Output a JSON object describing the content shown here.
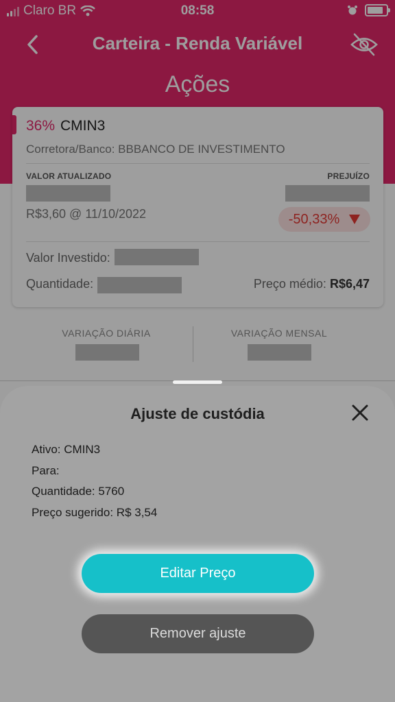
{
  "status_bar": {
    "carrier": "Claro BR",
    "time": "08:58"
  },
  "nav": {
    "title": "Carteira - Renda Variável"
  },
  "section": {
    "title": "Ações"
  },
  "card": {
    "percent": "36%",
    "ticker": "CMIN3",
    "broker": "Corretora/Banco: BBBANCO DE INVESTIMENTO",
    "valor_atualizado_label": "VALOR ATUALIZADO",
    "prejuizo_label": "PREJUÍZO",
    "price_date": "R$3,60 @ 11/10/2022",
    "loss_pct": "-50,33%",
    "valor_investido_label": "Valor Investido:",
    "quantidade_label": "Quantidade:",
    "preco_medio_label": "Preço médio:",
    "preco_medio_value": "R$6,47"
  },
  "variations": {
    "daily_label": "VARIAÇÃO DIÁRIA",
    "monthly_label": "VARIAÇÃO MENSAL"
  },
  "sheet": {
    "title": "Ajuste de custódia",
    "ativo": "Ativo: CMIN3",
    "para": "Para:",
    "quantidade": "Quantidade: 5760",
    "preco_sugerido": "Preço sugerido: R$ 3,54",
    "edit_button": "Editar Preço",
    "remove_button": "Remover ajuste"
  },
  "colors": {
    "brand": "#e2276a",
    "primary_button": "#16c0c9",
    "secondary_button": "#555555",
    "loss": "#e53935"
  }
}
